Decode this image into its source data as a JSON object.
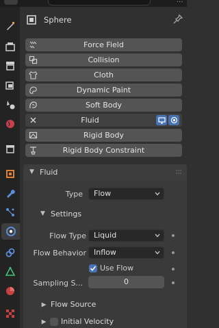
{
  "header": {
    "object_name": "Sphere"
  },
  "physics_buttons": [
    {
      "label": "Force Field",
      "icon": "force-field-icon"
    },
    {
      "label": "Collision",
      "icon": "collision-icon"
    },
    {
      "label": "Cloth",
      "icon": "cloth-icon"
    },
    {
      "label": "Dynamic Paint",
      "icon": "dynamic-paint-icon"
    },
    {
      "label": "Soft Body",
      "icon": "soft-body-icon"
    },
    {
      "label": "Fluid",
      "icon": "close-icon"
    },
    {
      "label": "Rigid Body",
      "icon": "rigid-body-icon"
    },
    {
      "label": "Rigid Body Constraint",
      "icon": "rigid-body-constraint-icon"
    }
  ],
  "fluid_panel": {
    "title": "Fluid",
    "type_label": "Type",
    "type_value": "Flow",
    "settings": {
      "title": "Settings",
      "flow_type_label": "Flow Type",
      "flow_type_value": "Liquid",
      "flow_behavior_label": "Flow Behavior",
      "flow_behavior_value": "Inflow",
      "use_flow_label": "Use Flow",
      "use_flow_checked": true,
      "sampling_label": "Sampling S...",
      "sampling_value": "0"
    },
    "flow_source_title": "Flow Source",
    "initial_velocity_title": "Initial Velocity"
  },
  "colors": {
    "accent": "#4772b3",
    "button": "#545454",
    "panel": "#303030"
  }
}
